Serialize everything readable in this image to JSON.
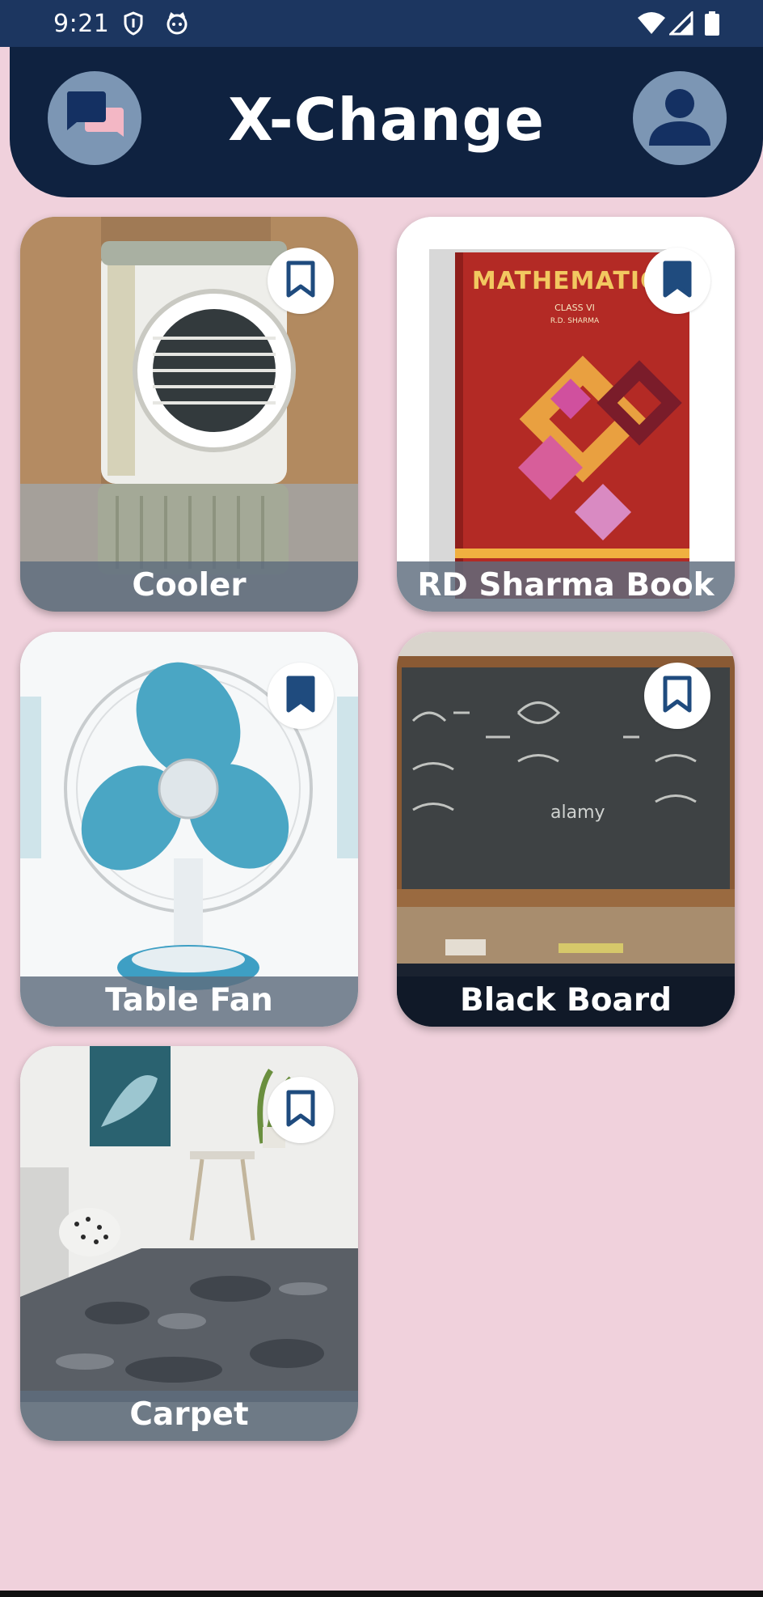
{
  "status_bar": {
    "time": "9:21",
    "left_icons": [
      "shield-icon",
      "cat-face-icon"
    ],
    "right_icons": [
      "wifi-icon",
      "signal-icon",
      "battery-icon"
    ]
  },
  "app_bar": {
    "title": "X-Change",
    "left_button_icon": "chat-bubbles-icon",
    "right_button_icon": "profile-icon"
  },
  "colors": {
    "background": "#f0d1dc",
    "app_bar": "#0f2240",
    "status_bar": "#1c3660",
    "accent": "#2b5688"
  },
  "items": [
    {
      "title": "Cooler",
      "bookmark": "bookmark-outline-icon",
      "bookmarked": false
    },
    {
      "title": "RD Sharma Book",
      "bookmark": "bookmark-filled-icon",
      "bookmarked": true,
      "book_title": "MATHEMATICS",
      "book_class": "CLASS VI",
      "book_author": "R.D. SHARMA"
    },
    {
      "title": "Table Fan",
      "bookmark": "bookmark-filled-icon",
      "bookmarked": true
    },
    {
      "title": "Black Board",
      "bookmark": "bookmark-outline-icon",
      "bookmarked": false,
      "watermark": "alamy"
    },
    {
      "title": "Carpet",
      "bookmark": "bookmark-outline-icon",
      "bookmarked": false
    }
  ]
}
